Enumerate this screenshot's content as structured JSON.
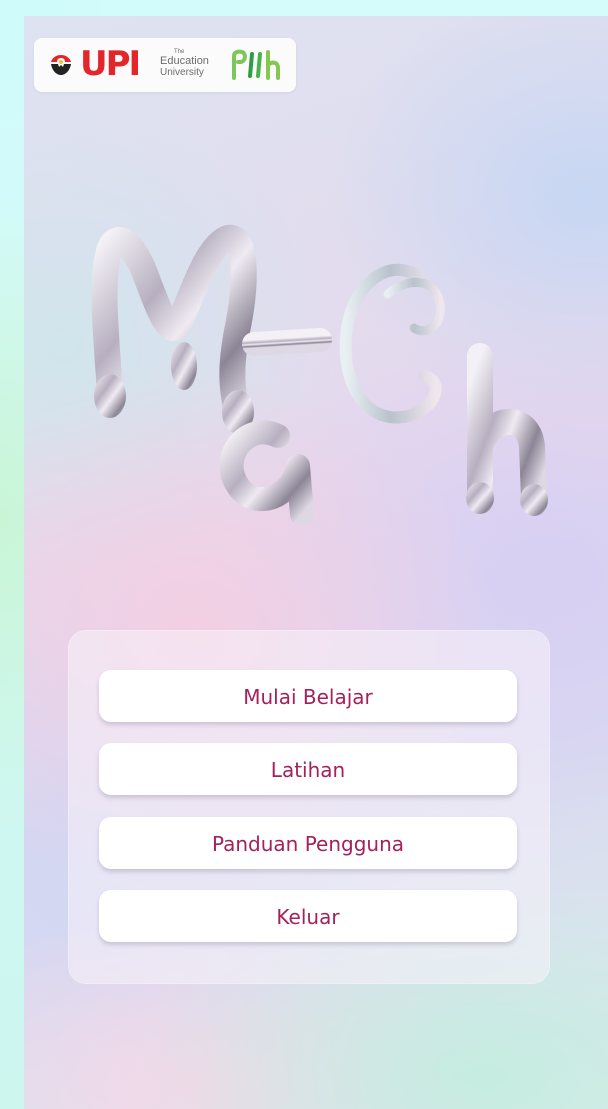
{
  "header": {
    "upi_logo_text": "UPI",
    "upi_subtitle_top": "The",
    "upi_subtitle_line1": "Education",
    "upi_subtitle_line2": "University",
    "partner_logo_text": "PKh",
    "upi_color": "#e3262b",
    "partner_color": "#4caf50"
  },
  "title_art": {
    "text": "MatCh",
    "icon": "chrome-3d-title-icon"
  },
  "menu": {
    "items": [
      {
        "label": "Mulai Belajar"
      },
      {
        "label": "Latihan"
      },
      {
        "label": "Panduan Pengguna"
      },
      {
        "label": "Keluar"
      }
    ],
    "label_color": "#a4215c"
  }
}
